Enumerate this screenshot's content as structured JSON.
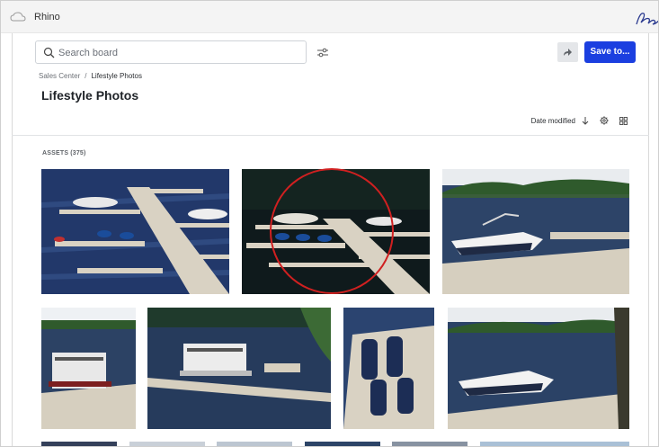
{
  "app": {
    "name": "Rhino"
  },
  "search": {
    "placeholder": "Search board",
    "value": ""
  },
  "toolbar": {
    "save_label": "Save to..."
  },
  "breadcrumb": {
    "parent": "Sales Center",
    "separator": "/",
    "current": "Lifestyle Photos"
  },
  "page": {
    "title": "Lifestyle Photos"
  },
  "sort": {
    "label": "Date modified"
  },
  "assets": {
    "label": "ASSETS",
    "count": "(375)",
    "items": [
      {
        "name": "asset-marina-aerial",
        "selected": false
      },
      {
        "name": "asset-marina-jetskis",
        "selected": true
      },
      {
        "name": "asset-speedboat-dock",
        "selected": false
      },
      {
        "name": "asset-pontoon-dock",
        "selected": false
      },
      {
        "name": "asset-pontoon-lake",
        "selected": false
      },
      {
        "name": "asset-jetski-ports",
        "selected": false
      },
      {
        "name": "asset-bowrider-dock",
        "selected": false
      }
    ]
  },
  "colors": {
    "accent": "#1b3fe0",
    "highlight": "#d02020",
    "water": "#2a3f63",
    "dock": "#d9d2c3"
  },
  "icons": [
    "cloud-icon",
    "signature-logo-icon",
    "search-icon",
    "filter-icon",
    "share-icon",
    "sort-down-icon",
    "settings-icon",
    "grid-view-icon"
  ]
}
